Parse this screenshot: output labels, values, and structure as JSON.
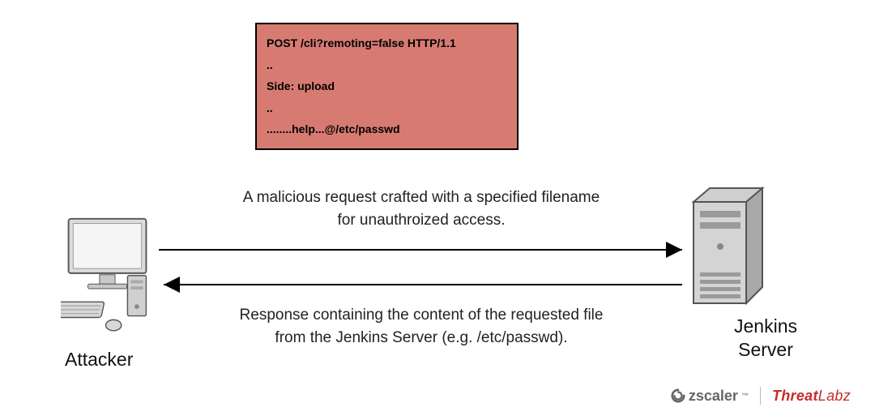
{
  "packet": {
    "line1": "POST /cli?remoting=false HTTP/1.1",
    "line2": "..",
    "line3": "Side: upload",
    "line4": "..",
    "line5": "........help...@/etc/passwd"
  },
  "labels": {
    "top_line1": "A malicious request crafted with a specified filename",
    "top_line2": "for unauthroized access.",
    "bottom_line1": "Response containing the content of the requested file",
    "bottom_line2": "from the Jenkins Server (e.g. /etc/passwd).",
    "attacker": "Attacker",
    "server": "Jenkins Server"
  },
  "brand": {
    "name1": "zscaler",
    "tm": "™",
    "name2_a": "Threat",
    "name2_b": "Labz"
  }
}
